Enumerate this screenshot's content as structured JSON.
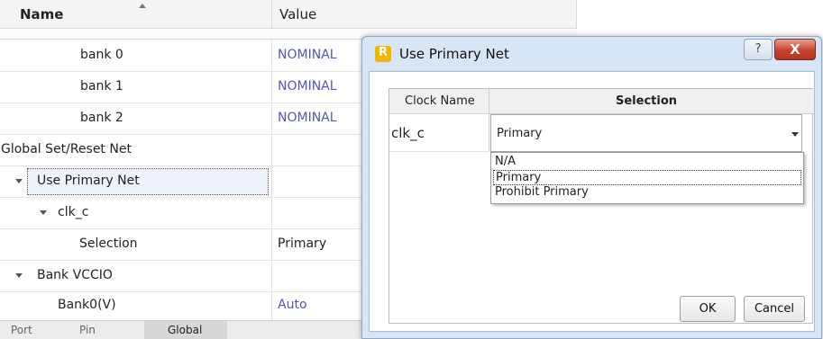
{
  "grid": {
    "header": {
      "name": "Name",
      "value": "Value"
    },
    "rows": [
      {
        "name": "bank 0",
        "value": "NOMINAL"
      },
      {
        "name": "bank 1",
        "value": "NOMINAL"
      },
      {
        "name": "bank 2",
        "value": "NOMINAL"
      },
      {
        "name": "Global Set/Reset Net",
        "value": ""
      },
      {
        "name": "Use Primary Net",
        "value": ""
      },
      {
        "name": "clk_c",
        "value": ""
      },
      {
        "name": "Selection",
        "value": "Primary"
      },
      {
        "name": "Bank VCCIO",
        "value": ""
      },
      {
        "name": "Bank0(V)",
        "value": "Auto"
      }
    ]
  },
  "tabs": [
    "Port",
    "Pin",
    "Global"
  ],
  "dialog": {
    "title": "Use Primary Net",
    "icon_letter": "R",
    "help_glyph": "?",
    "close_glyph": "X",
    "table": {
      "columns": [
        "Clock Name",
        "Selection"
      ],
      "clock_name": "clk_c",
      "selection": "Primary"
    },
    "dropdown_options": [
      "N/A",
      "Primary",
      "Prohibit Primary"
    ],
    "ok_label": "OK",
    "cancel_label": "Cancel"
  },
  "colors": {
    "value_blue": "#5555b8",
    "dialog_frame": "#d6e6f6",
    "close_red": "#c4432d"
  }
}
